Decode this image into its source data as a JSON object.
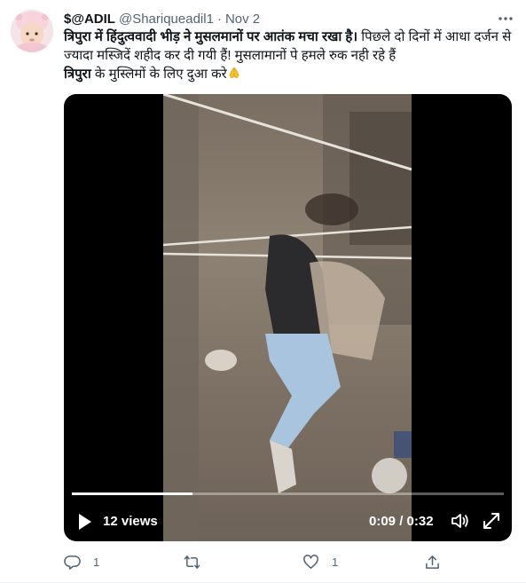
{
  "author": {
    "display_name": "$@ADIL",
    "handle": "@Shariqueadil1",
    "separator": "·",
    "date": "Nov 2",
    "avatar_icon": "baby-avatar-icon"
  },
  "tweet": {
    "line1_bold": "त्रिपुरा में हिंदुत्ववादी भीड़ ने मुसलमानों पर आतंक मचा रखा है।",
    "line1_rest": " पिछले दो दिनों में आधा दर्जन से ज्यादा मस्जिदें शहीद कर दी गयी हैं! मुसलामानों पे हमले रुक नही रहे हैं",
    "line3_bold": "त्रिपुरा",
    "line3_rest": " के मुस्लिमों के लिए दुआ करे",
    "emoji_icon": "praying-hands-icon"
  },
  "video": {
    "views": "12 views",
    "time": "0:09 / 0:32",
    "progress": 0.28
  },
  "actions": {
    "reply_count": "1",
    "retweet_count": "",
    "like_count": "1"
  },
  "colors": {
    "text_primary": "#0f1419",
    "text_secondary": "#536471",
    "divider": "#eff3f4"
  }
}
